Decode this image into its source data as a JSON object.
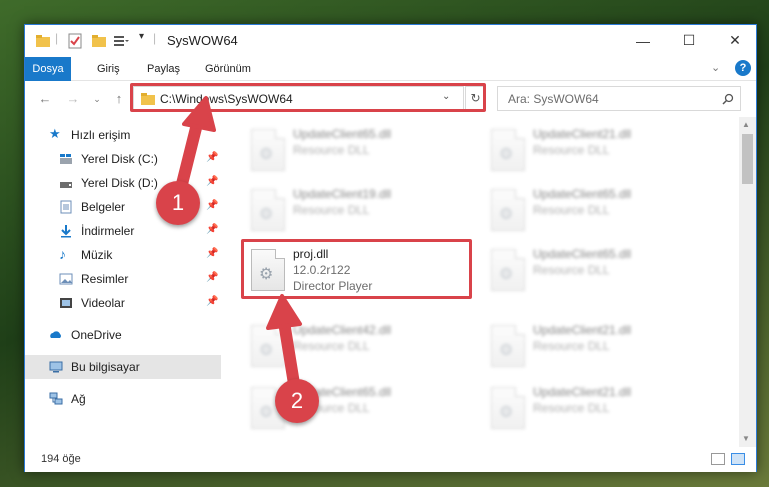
{
  "window": {
    "title": "SysWOW64",
    "controls": {
      "minimize": "—",
      "maximize": "☐",
      "close": "✕"
    }
  },
  "ribbon": {
    "tabs": [
      {
        "label": "Dosya",
        "active": true
      },
      {
        "label": "Giriş"
      },
      {
        "label": "Paylaş"
      },
      {
        "label": "Görünüm"
      }
    ],
    "help_icon": "help-icon"
  },
  "nav": {
    "address": "C:\\Windows\\SysWOW64",
    "search_placeholder": "Ara: SysWOW64"
  },
  "sidebar": {
    "quick_access": "Hızlı erişim",
    "items": [
      {
        "label": "Yerel Disk (C:)",
        "icon": "drive-icon",
        "pinned": true
      },
      {
        "label": "Yerel Disk (D:)",
        "icon": "drive-icon",
        "pinned": true
      },
      {
        "label": "Belgeler",
        "icon": "documents-icon",
        "pinned": true
      },
      {
        "label": "İndirmeler",
        "icon": "downloads-icon",
        "pinned": true
      },
      {
        "label": "Müzik",
        "icon": "music-icon",
        "pinned": true
      },
      {
        "label": "Resimler",
        "icon": "pictures-icon",
        "pinned": true
      },
      {
        "label": "Videolar",
        "icon": "videos-icon",
        "pinned": true
      }
    ],
    "onedrive": "OneDrive",
    "this_pc": "Bu bilgisayar",
    "network": "Ağ"
  },
  "files": {
    "left": [
      {
        "name": "UpdateClient65.dll",
        "desc": "Resource DLL"
      },
      {
        "name": "UpdateClient19.dll",
        "desc": "Resource DLL"
      },
      {
        "name": "proj.dll",
        "version": "12.0.2r122",
        "desc": "Director Player"
      },
      {
        "name": "UpdateClient42.dll",
        "desc": "Resource DLL"
      },
      {
        "name": "UpdateClient65.dll",
        "desc": "Resource DLL"
      }
    ],
    "right": [
      {
        "name": "UpdateClient21.dll",
        "desc": "Resource DLL"
      },
      {
        "name": "UpdateClient65.dll",
        "desc": "Resource DLL"
      },
      {
        "name": "UpdateClient65.dll",
        "desc": "Resource DLL"
      },
      {
        "name": "UpdateClient21.dll",
        "desc": "Resource DLL"
      },
      {
        "name": "UpdateClient21.dll",
        "desc": "Resource DLL"
      }
    ]
  },
  "status": {
    "item_count": "194 öğe"
  },
  "annotations": {
    "step1": "1",
    "step2": "2",
    "color": "#d9434a"
  }
}
